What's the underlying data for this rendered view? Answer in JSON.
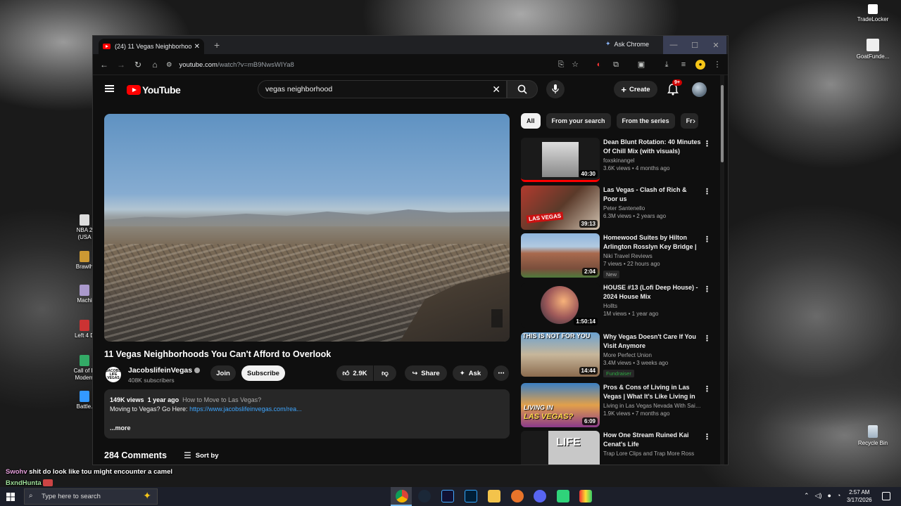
{
  "browser": {
    "tab_title": "(24) 11 Vegas Neighborhoods Y",
    "tab_close": "✕",
    "new_tab": "+",
    "ask_chrome": "Ask Chrome",
    "url_host": "youtube.com",
    "url_path": "/watch?v=mB9NwsWIYa8"
  },
  "youtube": {
    "logo_text": "YouTube",
    "search_value": "vegas neighborhood",
    "create_label": "Create",
    "notif_badge": "9+"
  },
  "video": {
    "title": "11 Vegas Neighborhoods You Can't Afford to Overlook",
    "channel_name": "JacobslifeinVegas",
    "channel_avatar_text": "JACOBS LIFE VEGAS",
    "subscribers": "408K subscribers",
    "join_label": "Join",
    "subscribe_label": "Subscribe",
    "likes": "2.9K",
    "share_label": "Share",
    "ask_label": "Ask",
    "more_label": "⋯",
    "views": "149K views",
    "age": "1 year ago",
    "description_tag": "How to Move to Las Vegas?",
    "description_line": "Moving to Vegas? Go Here:",
    "description_link": "https://www.jacobslifeinvegas.com/rea...",
    "description_more": "...more",
    "comments_count": "284 Comments",
    "sort_by": "Sort by"
  },
  "chips": [
    "All",
    "From your search",
    "From the series",
    "Fr"
  ],
  "recommendations": [
    {
      "title": "Dean Blunt Rotation: 40 Minutes Of Chill Mix (with visuals)",
      "channel": "foxskinangel",
      "meta": "3.6K views • 4 months ago",
      "duration": "40:30",
      "badge": ""
    },
    {
      "title": "Las Vegas - Clash of Rich & Poor us",
      "channel": "Peter Santenello",
      "meta": "6.3M views • 2 years ago",
      "duration": "39:13",
      "badge": ""
    },
    {
      "title": "Homewood Suites by Hilton Arlington Rosslyn Key Bridge | ...",
      "channel": "Niki Travel Reviews",
      "meta": "7 views • 22 hours ago",
      "duration": "2:04",
      "badge": "New"
    },
    {
      "title": "HOUSE #13 (Lofi Deep House) - 2024 House Mix",
      "channel": "Hollts",
      "meta": "1M views • 1 year ago",
      "duration": "1:50:14",
      "badge": ""
    },
    {
      "title": "Why Vegas Doesn't Care If You Visit Anymore",
      "channel": "More Perfect Union",
      "meta": "3.4M views • 3 weeks ago",
      "duration": "14:44",
      "badge": "Fundraiser"
    },
    {
      "title": "Pros & Cons of Living in Las Vegas | What It's Like Living in ...",
      "channel": "Living in Las Vegas Nevada With Sai Bro...",
      "meta": "1.9K views • 7 months ago",
      "duration": "6:09",
      "badge": ""
    },
    {
      "title": "How One Stream Ruined Kai Cenat's Life",
      "channel": "Trap Lore Clips and Trap More Ross",
      "meta": "",
      "duration": "",
      "badge": ""
    }
  ],
  "thumb_text": {
    "rec1": "LAS VEGAS",
    "rec4": "THIS IS NOT FOR YOU",
    "rec5_top": "LIVING IN",
    "rec5_bottom": "LAS VEGAS?",
    "rec6": "LIFE"
  },
  "desktop": {
    "icons_right": [
      "TradeLocker",
      "GoatFunde...",
      "Recycle Bin"
    ],
    "icons_left": [
      "NBA 2",
      "(USA",
      "Brawlh",
      "Machi",
      "Left 4 D",
      "Call of D Modern",
      "Battle."
    ]
  },
  "chat": [
    {
      "user": "Swohv",
      "message": "shit do look like tou might encounter a camel"
    },
    {
      "user": "BxndHunta",
      "message": ""
    }
  ],
  "taskbar": {
    "search_placeholder": "Type here to search",
    "time": "2:57 AM",
    "date": "3/17/2026"
  },
  "colors": {
    "yt_red": "#ff0000",
    "link_blue": "#3ea6ff",
    "bg": "#0f0f0f",
    "chip_bg": "#272727"
  }
}
